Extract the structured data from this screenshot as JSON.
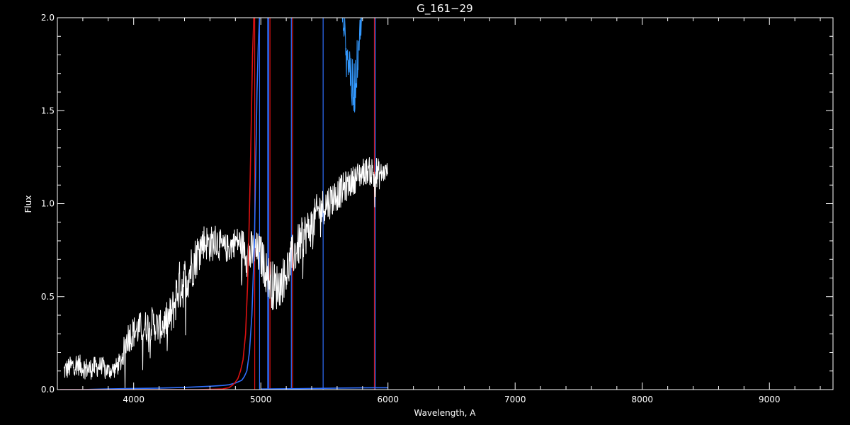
{
  "chart_data": {
    "type": "line",
    "title": "G_161−29",
    "xlabel": "Wavelength, A",
    "ylabel": "Flux",
    "xlim": [
      3400,
      9500
    ],
    "ylim": [
      0,
      2.0
    ],
    "x_ticks": [
      4000,
      5000,
      6000,
      7000,
      8000,
      9000
    ],
    "x_tick_labels": [
      "4000",
      "5000",
      "6000",
      "7000",
      "8000",
      "9000"
    ],
    "y_ticks": [
      0.0,
      0.5,
      1.0,
      1.5,
      2.0
    ],
    "y_tick_labels": [
      "0.0",
      "0.5",
      "1.0",
      "1.5",
      "2.0"
    ],
    "grid": false,
    "background": "#000000",
    "foreground": "#ffffff",
    "series": [
      {
        "color": "#ffffff",
        "style": "noisy-spectrum",
        "x": [
          3450,
          3500,
          3550,
          3600,
          3650,
          3700,
          3750,
          3800,
          3850,
          3900,
          3950,
          4000,
          4050,
          4100,
          4150,
          4200,
          4250,
          4300,
          4350,
          4400,
          4450,
          4500,
          4550,
          4600,
          4650,
          4700,
          4750,
          4800,
          4850,
          4900,
          4950,
          5000,
          5050,
          5100,
          5150,
          5200,
          5250,
          5300,
          5350,
          5400,
          5450,
          5500,
          5550,
          5600,
          5650,
          5700,
          5750,
          5800,
          5850,
          5900,
          5950,
          6000
        ],
        "y": [
          0.1,
          0.12,
          0.14,
          0.12,
          0.11,
          0.12,
          0.13,
          0.1,
          0.11,
          0.15,
          0.28,
          0.31,
          0.33,
          0.34,
          0.36,
          0.33,
          0.36,
          0.4,
          0.55,
          0.58,
          0.65,
          0.73,
          0.8,
          0.78,
          0.8,
          0.76,
          0.76,
          0.8,
          0.79,
          0.72,
          0.74,
          0.72,
          0.62,
          0.55,
          0.56,
          0.63,
          0.72,
          0.78,
          0.84,
          0.88,
          0.96,
          0.99,
          1.02,
          1.05,
          1.08,
          1.11,
          1.14,
          1.17,
          1.18,
          1.15,
          1.16,
          1.18
        ],
        "noise": [
          0.06,
          0.06,
          0.06,
          0.06,
          0.06,
          0.06,
          0.05,
          0.05,
          0.05,
          0.06,
          0.09,
          0.09,
          0.09,
          0.09,
          0.09,
          0.09,
          0.1,
          0.12,
          0.14,
          0.14,
          0.13,
          0.12,
          0.1,
          0.1,
          0.1,
          0.08,
          0.08,
          0.08,
          0.08,
          0.14,
          0.12,
          0.12,
          0.12,
          0.14,
          0.12,
          0.12,
          0.12,
          0.12,
          0.12,
          0.11,
          0.11,
          0.1,
          0.1,
          0.09,
          0.09,
          0.08,
          0.08,
          0.08,
          0.07,
          0.12,
          0.06,
          0.05
        ]
      },
      {
        "color": "#2f6fff",
        "style": "line",
        "x": [
          3420,
          3600,
          3800,
          4000,
          4200,
          4400,
          4600,
          4700,
          4750,
          4800,
          4850,
          4870,
          4890,
          4910,
          4930,
          4950,
          4960,
          4970,
          4980,
          4990,
          5000
        ],
        "y": [
          0.0,
          0.0,
          0.004,
          0.006,
          0.008,
          0.012,
          0.018,
          0.022,
          0.026,
          0.035,
          0.05,
          0.07,
          0.1,
          0.2,
          0.4,
          0.8,
          1.2,
          1.6,
          1.85,
          2.0,
          2.0
        ]
      },
      {
        "color": "#2f6fff",
        "style": "line",
        "x": [
          5000,
          5300,
          5600,
          5900,
          6000
        ],
        "y": [
          0.003,
          0.005,
          0.008,
          0.01,
          0.01
        ]
      },
      {
        "color": "#3399ff",
        "style": "noisy-spectrum",
        "x": [
          5640,
          5650,
          5660,
          5670,
          5680,
          5690,
          5700,
          5710,
          5720,
          5730,
          5740,
          5750,
          5760,
          5770,
          5780,
          5790,
          5800
        ],
        "y": [
          2.0,
          1.97,
          1.92,
          1.88,
          1.83,
          1.78,
          1.74,
          1.68,
          1.62,
          1.6,
          1.65,
          1.7,
          1.78,
          1.86,
          1.93,
          1.98,
          2.0
        ],
        "noise": [
          0.03,
          0.05,
          0.08,
          0.1,
          0.12,
          0.14,
          0.16,
          0.16,
          0.16,
          0.16,
          0.16,
          0.14,
          0.12,
          0.1,
          0.08,
          0.06,
          0.03
        ]
      },
      {
        "color": "#dd1111",
        "style": "line",
        "x": [
          3420,
          3800,
          4200,
          4500,
          4700,
          4750,
          4780,
          4800,
          4820,
          4840,
          4860,
          4880,
          4895,
          4905,
          4915,
          4925,
          4935,
          4945
        ],
        "y": [
          0.0,
          0.0,
          0.0,
          0.0,
          0.004,
          0.01,
          0.025,
          0.04,
          0.06,
          0.1,
          0.16,
          0.3,
          0.55,
          0.8,
          1.1,
          1.45,
          1.8,
          2.0
        ]
      }
    ],
    "vertical_lines": [
      {
        "x": 4952,
        "color": "#dd1111"
      },
      {
        "x": 4990,
        "color": "#2f6fff"
      },
      {
        "x": 5054,
        "color": "#2f6fff"
      },
      {
        "x": 5062,
        "color": "#2f6fff"
      },
      {
        "x": 5072,
        "color": "#dd1111"
      },
      {
        "x": 5240,
        "color": "#2f6fff"
      },
      {
        "x": 5250,
        "color": "#dd1111"
      },
      {
        "x": 5490,
        "color": "#2f6fff"
      },
      {
        "x": 5893,
        "color": "#dd1111"
      },
      {
        "x": 5900,
        "color": "#2f6fff"
      }
    ]
  }
}
